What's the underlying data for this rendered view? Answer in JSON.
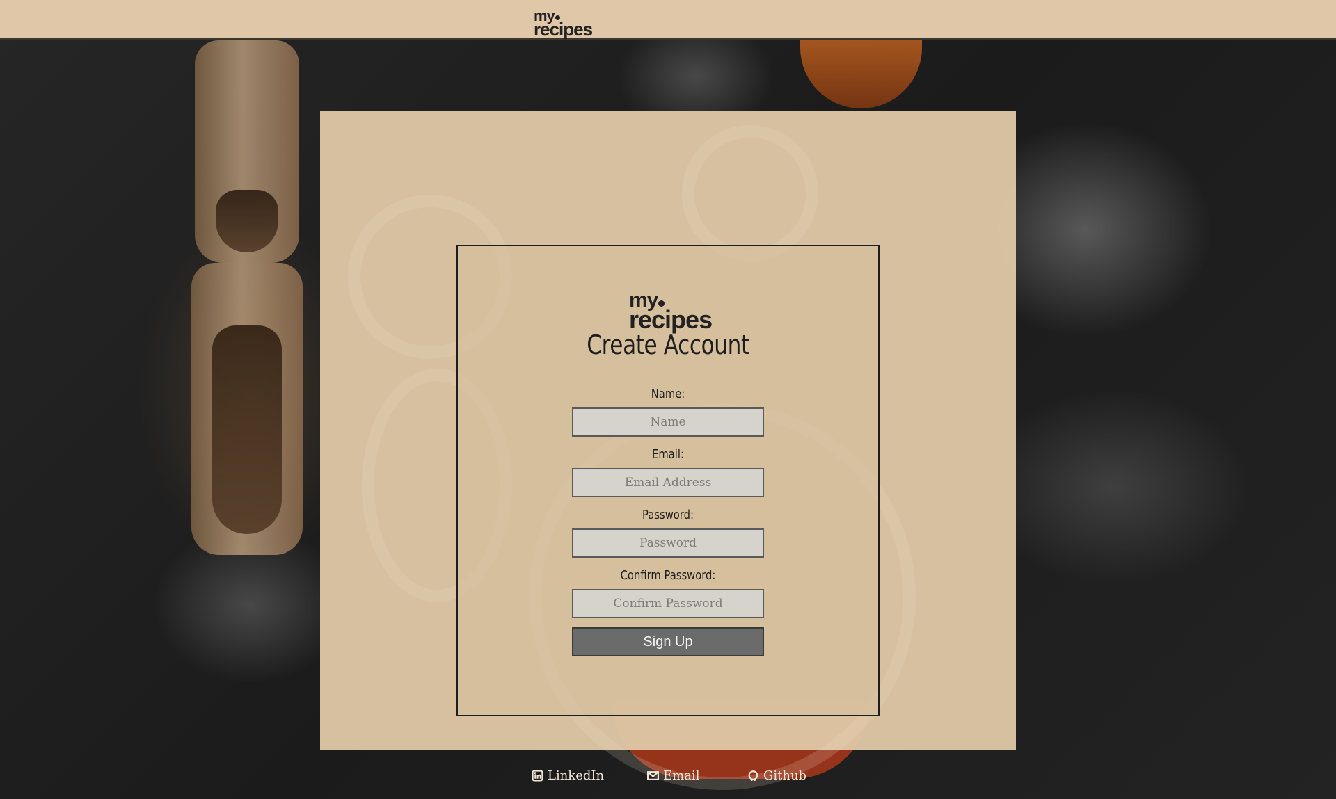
{
  "header": {
    "logo_line1": "my",
    "logo_line2": "recipes"
  },
  "form": {
    "logo_line1": "my",
    "logo_line2": "recipes",
    "title": "Create Account",
    "name_label": "Name:",
    "name_placeholder": "Name",
    "email_label": "Email:",
    "email_placeholder": "Email Address",
    "password_label": "Password:",
    "password_placeholder": "Password",
    "confirm_label": "Confirm Password:",
    "confirm_placeholder": "Confirm Password",
    "submit_label": "Sign Up"
  },
  "footer": {
    "links": [
      {
        "label": "LinkedIn",
        "icon": "linkedin-icon"
      },
      {
        "label": "Email",
        "icon": "envelope-icon"
      },
      {
        "label": "Github",
        "icon": "github-icon"
      }
    ]
  },
  "colors": {
    "header_bg": "#dfc7a7",
    "panel_bg": "#dec7a6",
    "button_bg": "#6b6b6b",
    "input_bg": "#d6d3cd"
  }
}
